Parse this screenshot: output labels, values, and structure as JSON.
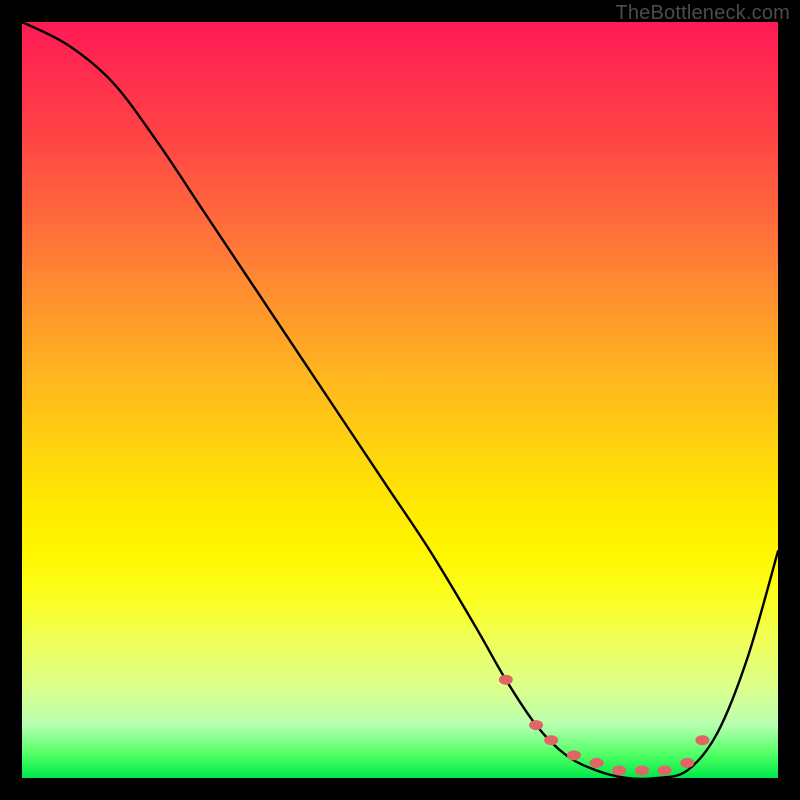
{
  "watermark": "TheBottleneck.com",
  "chart_data": {
    "type": "line",
    "title": "",
    "xlabel": "",
    "ylabel": "",
    "xlim": [
      0,
      100
    ],
    "ylim": [
      0,
      100
    ],
    "grid": false,
    "series": [
      {
        "name": "bottleneck-curve",
        "x": [
          0,
          6,
          12,
          18,
          24,
          30,
          36,
          42,
          48,
          54,
          60,
          64,
          68,
          72,
          76,
          80,
          84,
          88,
          92,
          96,
          100
        ],
        "y": [
          100,
          97,
          92,
          84,
          75,
          66,
          57,
          48,
          39,
          30,
          20,
          13,
          7,
          3,
          1,
          0,
          0,
          1,
          6,
          16,
          30
        ]
      }
    ],
    "markers": {
      "name": "highlight-dots",
      "color": "#e06666",
      "x": [
        64,
        68,
        70,
        73,
        76,
        79,
        82,
        85,
        88,
        90
      ],
      "y": [
        13,
        7,
        5,
        3,
        2,
        1,
        1,
        1,
        2,
        5
      ]
    }
  }
}
